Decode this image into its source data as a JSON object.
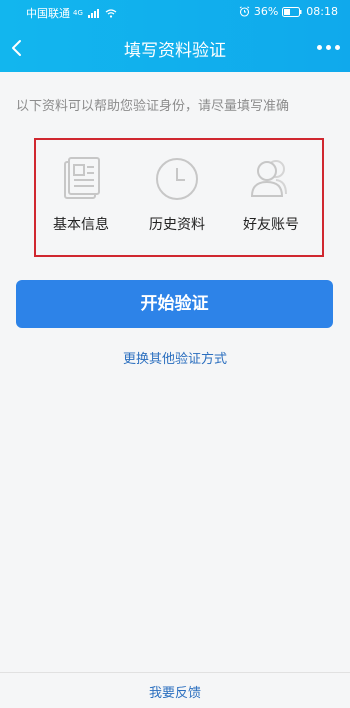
{
  "status_bar": {
    "carrier": "中国联通",
    "network": "4G",
    "battery": "36%",
    "time": "08:18",
    "alarm_icon": "alarm-icon",
    "battery_icon": "battery-icon"
  },
  "nav": {
    "title": "填写资料验证",
    "back_icon": "back-arrow-icon",
    "more_icon": "more-dots-icon"
  },
  "intro": "以下资料可以帮助您验证身份，请尽量填写准确",
  "options": [
    {
      "label": "基本信息",
      "icon": "document-icon"
    },
    {
      "label": "历史资料",
      "icon": "clock-icon"
    },
    {
      "label": "好友账号",
      "icon": "friends-icon"
    }
  ],
  "start_button_label": "开始验证",
  "switch_method_label": "更换其他验证方式",
  "feedback_label": "我要反馈",
  "colors": {
    "header": "#12b6ee",
    "primary_button": "#2d83e8",
    "highlight_border": "#d0272f",
    "link": "#2b6fbf",
    "icon_gray": "#c7c7c7"
  }
}
